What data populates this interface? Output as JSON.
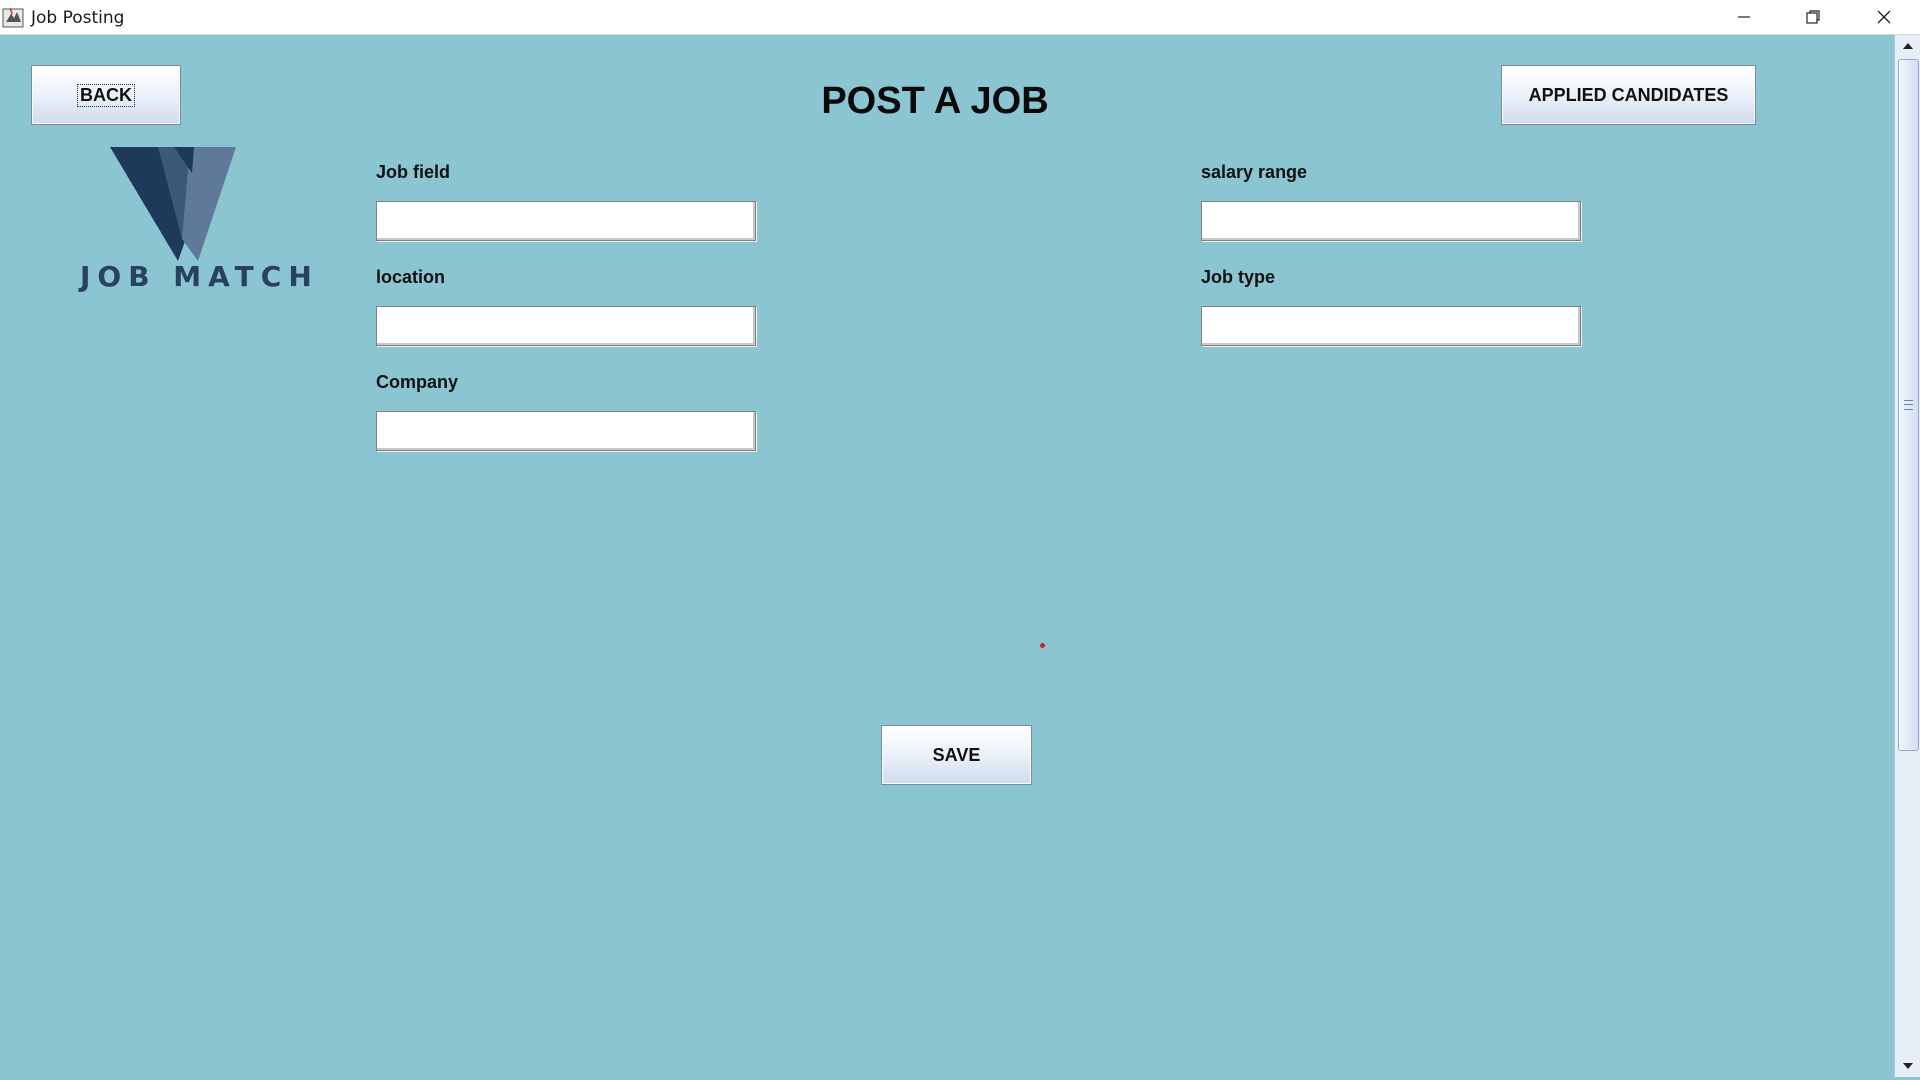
{
  "window": {
    "title": "Job Posting",
    "icons": {
      "app": "java-app-icon",
      "minimize": "minimize-icon",
      "maximize": "restore-icon",
      "close": "close-icon"
    }
  },
  "header": {
    "back_label": "BACK",
    "page_title": "POST A JOB",
    "applied_candidates_label": "APPLIED CANDIDATES"
  },
  "logo": {
    "text": "JOB MATCH",
    "colors": {
      "dark": "#1e3a5a",
      "mid": "#3c5a78",
      "light": "#5f7a98"
    }
  },
  "form": {
    "job_field": {
      "label": "Job field",
      "value": "",
      "placeholder": ""
    },
    "location": {
      "label": "location",
      "value": "",
      "placeholder": ""
    },
    "company": {
      "label": "Company",
      "value": "",
      "placeholder": ""
    },
    "salary_range": {
      "label": "salary range",
      "value": "",
      "placeholder": ""
    },
    "job_type": {
      "label": "Job type",
      "value": "",
      "placeholder": ""
    }
  },
  "actions": {
    "save_label": "SAVE"
  },
  "colors": {
    "background": "#8bc5d2",
    "accent_dot": "#d0202a"
  }
}
